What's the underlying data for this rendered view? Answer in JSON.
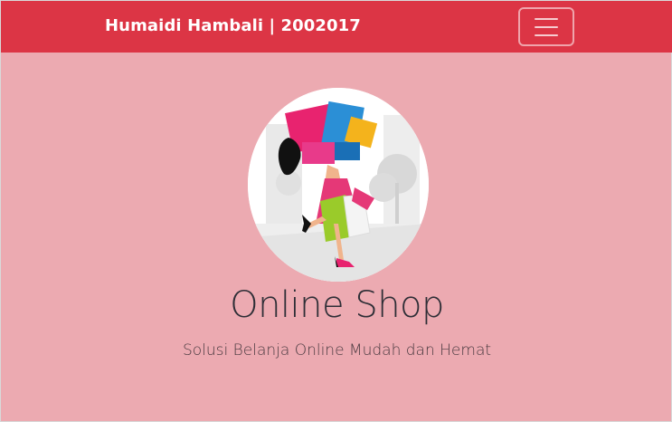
{
  "navbar": {
    "brand": "Humaidi Hambali | 2002017",
    "toggler_icon": "hamburger-menu-icon"
  },
  "hero": {
    "image_desc": "shopping-woman-illustration",
    "title": "Online Shop",
    "subtitle": "Solusi Belanja Online Mudah dan Hemat"
  },
  "colors": {
    "navbar_bg": "#dc3545",
    "page_bg": "#ecaab1"
  }
}
